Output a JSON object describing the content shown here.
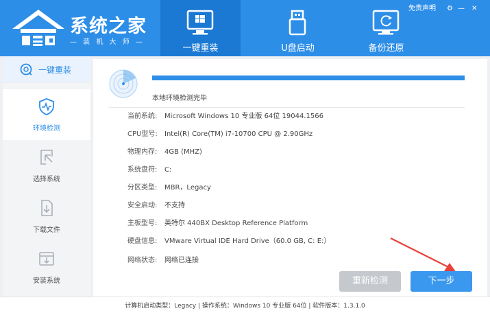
{
  "app": {
    "title": "系统之家",
    "subtitle": "— 装 机 大 师 —"
  },
  "header": {
    "tabs": [
      {
        "label": "一键重装",
        "icon": "windows-install-icon",
        "active": true
      },
      {
        "label": "U盘启动",
        "icon": "usb-drive-icon",
        "active": false
      },
      {
        "label": "备份还原",
        "icon": "backup-restore-icon",
        "active": false
      }
    ],
    "window_controls": {
      "statement": "免责声明",
      "settings": "⚙",
      "minimize": "—",
      "close": "✕"
    }
  },
  "sidebar": {
    "top": {
      "label": "一键重装",
      "icon": "refresh-circle-icon"
    },
    "items": [
      {
        "label": "环境检测",
        "icon": "shield-pulse-icon",
        "active": true
      },
      {
        "label": "选择系统",
        "icon": "cursor-select-icon",
        "active": false
      },
      {
        "label": "下载文件",
        "icon": "file-download-icon",
        "active": false
      },
      {
        "label": "安装系统",
        "icon": "install-box-icon",
        "active": false
      }
    ]
  },
  "main": {
    "progress": {
      "percent": 100,
      "text": "本地环境检测完毕"
    },
    "info": [
      {
        "key": "当前系统:",
        "value": "Microsoft Windows 10 专业版 64位 19044.1566"
      },
      {
        "key": "CPU型号:",
        "value": "Intel(R) Core(TM) i7-10700 CPU @ 2.90GHz"
      },
      {
        "key": "物理内存:",
        "value": "4GB (MHZ)"
      },
      {
        "key": "系统盘符:",
        "value": "C:"
      },
      {
        "key": "分区类型:",
        "value": "MBR，Legacy"
      },
      {
        "key": "安全启动:",
        "value": "不支持"
      },
      {
        "key": "主板型号:",
        "value": "英特尔 440BX Desktop Reference Platform"
      },
      {
        "key": "硬盘信息:",
        "value": "VMware Virtual IDE Hard Drive（60.0 GB, C: E:）"
      },
      {
        "key": "网络状态:",
        "value": "网络已连接"
      }
    ],
    "buttons": {
      "recheck": "重新检测",
      "next": "下一步"
    }
  },
  "statusbar": {
    "text": "计算机启动类型：Legacy | 操作系统：Windows 10 专业版 64位 | 软件版本：1.3.1.0"
  },
  "colors": {
    "brand": "#2d8ee8",
    "active_tab": "#1b79d3",
    "arrow": "#e8403a"
  }
}
